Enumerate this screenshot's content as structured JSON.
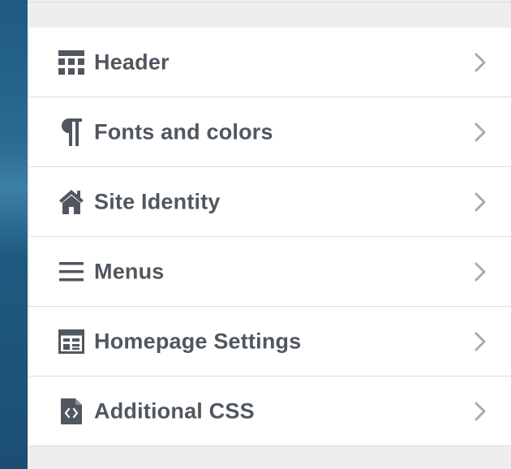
{
  "sidebar": {
    "items": [
      {
        "label": "Header",
        "icon": "header-layout-icon"
      },
      {
        "label": "Fonts and colors",
        "icon": "paragraph-icon"
      },
      {
        "label": "Site Identity",
        "icon": "home-icon"
      },
      {
        "label": "Menus",
        "icon": "menu-icon"
      },
      {
        "label": "Homepage Settings",
        "icon": "layout-table-icon"
      },
      {
        "label": "Additional CSS",
        "icon": "code-file-icon"
      }
    ],
    "chevron_icon": "chevron-right-icon"
  },
  "colors": {
    "text": "#50575e",
    "chevron": "#a7aaad",
    "panel_bg": "#eeeeee",
    "item_bg": "#ffffff",
    "divider": "#dcdcde"
  }
}
